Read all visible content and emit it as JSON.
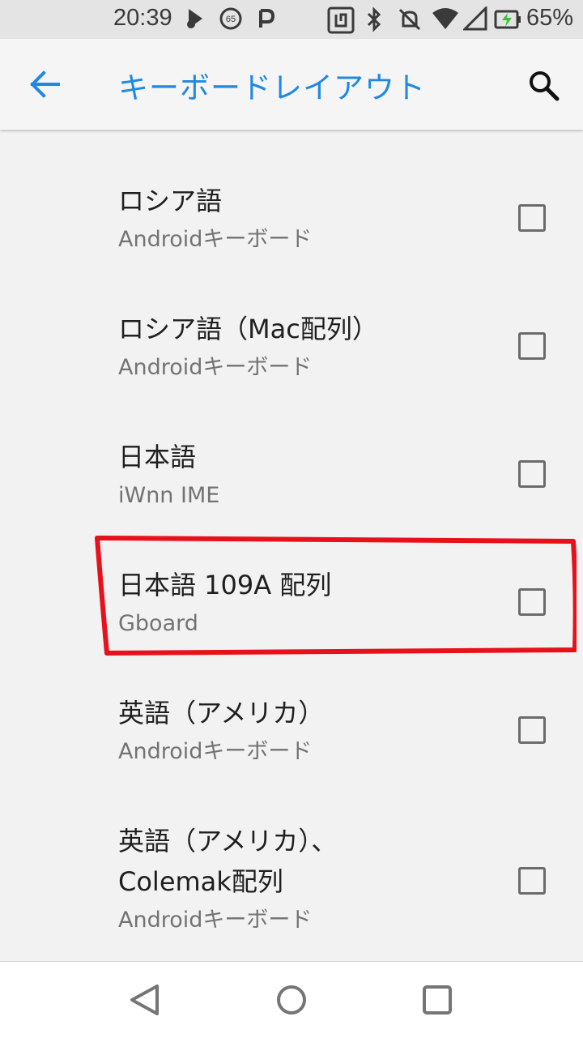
{
  "status_bar": {
    "time": "20:39",
    "battery_percent": "65%",
    "icons": [
      "media-icon",
      "speed-badge-icon",
      "parking-icon",
      "nfc-icon",
      "bluetooth-icon",
      "notifications-off-icon",
      "wifi-icon",
      "signal-icon",
      "battery-charging-icon"
    ],
    "speed_badge": "65"
  },
  "app_bar": {
    "title": "キーボードレイアウト",
    "accent_color": "#1e88e5"
  },
  "layouts": [
    {
      "title": "ロシア語",
      "subtitle": "Androidキーボード",
      "checked": false
    },
    {
      "title": "ロシア語（Mac配列）",
      "subtitle": "Androidキーボード",
      "checked": false
    },
    {
      "title": "日本語",
      "subtitle": "iWnn IME",
      "checked": false
    },
    {
      "title": "日本語 109A 配列",
      "subtitle": "Gboard",
      "checked": false
    },
    {
      "title": "英語（アメリカ）",
      "subtitle": "Androidキーボード",
      "checked": false
    },
    {
      "title_line1": "英語（アメリカ）、",
      "title_line2": "Colemak配列",
      "subtitle": "Androidキーボード",
      "checked": false
    }
  ],
  "annotation_color": "#e8101a"
}
